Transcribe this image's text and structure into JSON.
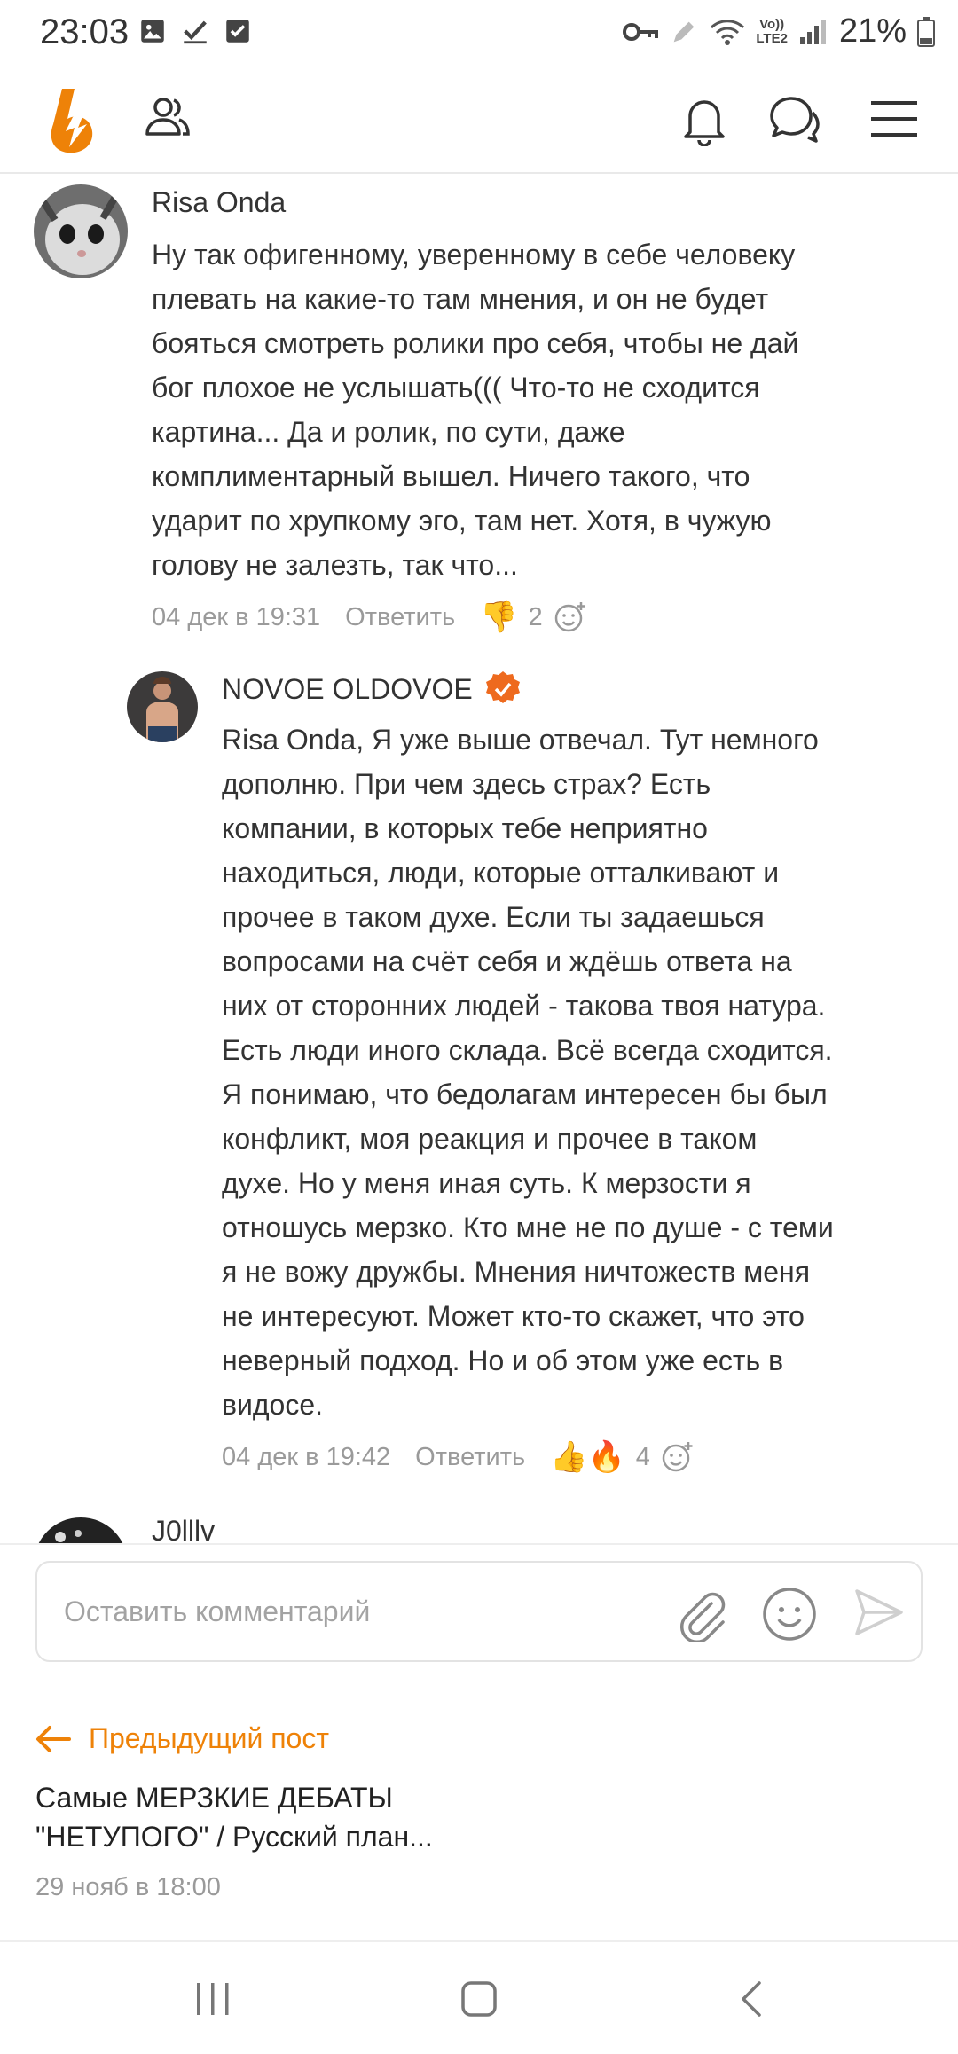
{
  "status_bar": {
    "time": "23:03",
    "battery": "21%",
    "network": "LTE2"
  },
  "header": {
    "logo_icon": "odnoklassniki-logo-icon",
    "brand_color": "#ee8208"
  },
  "comments": [
    {
      "author": "Risa Onda",
      "text": "Ну так офигенному, уверенному в себе человеку\nплевать на какие-то там мнения, и он не будет\nбояться смотреть ролики про себя, чтобы не дай\nбог плохое не услышать((( Что-то не сходится\nкартина... Да и ролик, по сути, даже\nкомплиментарный вышел. Ничего такого, что\nударит по хрупкому эго, там нет. Хотя, в чужую\nголову не залезть, так что...",
      "date": "04 дек в 19:31",
      "reply_label": "Ответить",
      "reaction": "👎",
      "reaction_count": "2"
    },
    {
      "author": "NOVOE OLDOVOE",
      "verified": true,
      "text": "Risa Onda, Я уже выше отвечал. Тут немного\nдополню. При чем здесь страх? Есть\nкомпании, в которых тебе неприятно\nнаходиться, люди, которые отталкивают и\nпрочее в таком духе. Если ты задаешься\nвопросами на счёт себя и ждёшь ответа на\nних от сторонних людей - такова твоя натура.\nЕсть люди иного склада. Всё всегда сходится.\nЯ понимаю, что бедолагам интересен бы был\nконфликт, моя реакция и прочее в таком\nдухе. Но у меня иная суть. К мерзости я\nотношусь мерзко. Кто мне не по душе - с теми\nя не вожу дружбы. Мнения ничтожеств меня\nне интересуют. Может кто-то скажет, что это\nневерный подход. Но и об этом уже есть в\nвидосе.",
      "date": "04 дек в 19:42",
      "reply_label": "Ответить",
      "reaction": "👍🔥",
      "reaction_count": "4"
    },
    {
      "author": "J0lllv"
    }
  ],
  "composer": {
    "placeholder": "Оставить комментарий"
  },
  "previous_post": {
    "label": "Предыдущий пост",
    "title": "Самые МЕРЗКИЕ ДЕБАТЫ \"НЕТУПОГО\" / Русский план...",
    "date": "29 нояб в 18:00"
  }
}
